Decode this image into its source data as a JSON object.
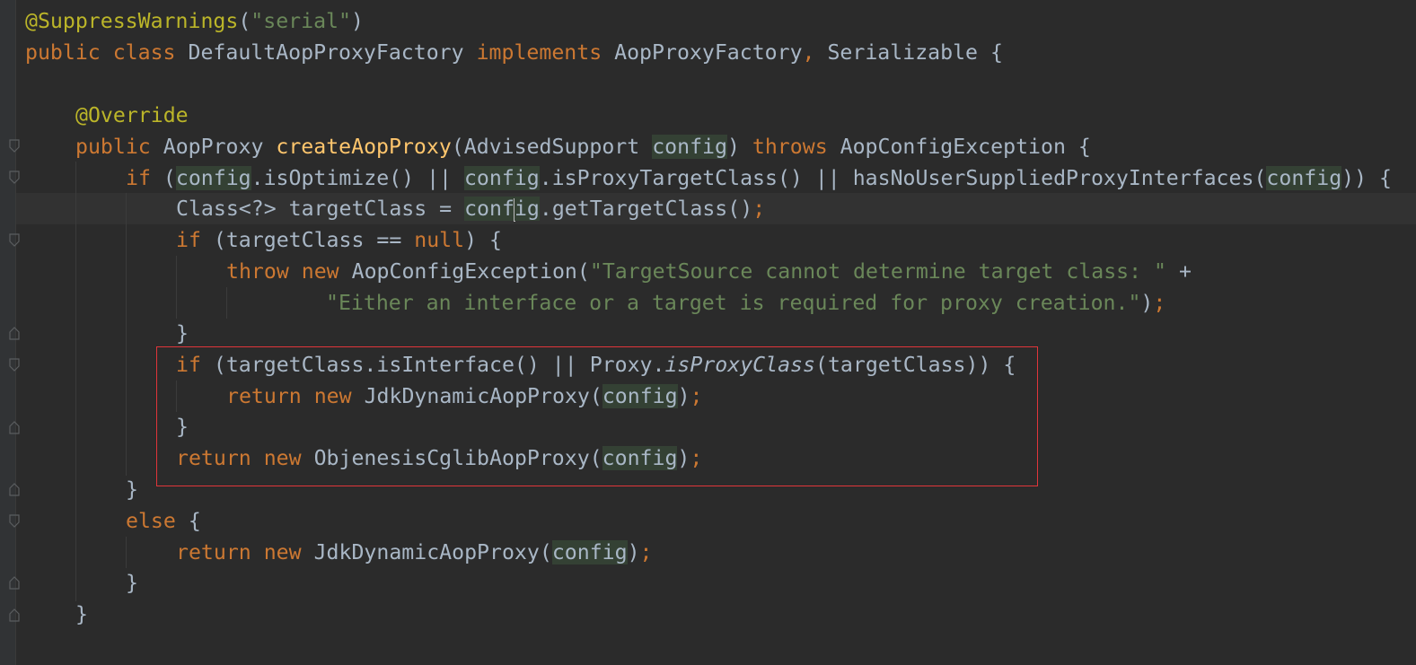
{
  "editor": {
    "language": "java",
    "theme_colors": {
      "background": "#2b2b2b",
      "keyword": "#cc7832",
      "annotation": "#bbb529",
      "string": "#6a8759",
      "method_declaration": "#ffc66d",
      "plain": "#a9b7c6",
      "usage_highlight": "#344134",
      "selection_box": "#e0353a"
    },
    "lines": [
      {
        "segments": [
          "@SuppressWarnings",
          "(",
          "\"serial\"",
          ")"
        ]
      },
      {
        "segments": [
          "public class ",
          "DefaultAopProxyFactory ",
          "implements ",
          "AopProxyFactory",
          ", ",
          "Serializable {"
        ]
      },
      {
        "segments": []
      },
      {
        "segments": [
          "@Override"
        ]
      },
      {
        "segments": [
          "public ",
          "AopProxy ",
          "createAopProxy",
          "(AdvisedSupport ",
          "config",
          ") ",
          "throws ",
          "AopConfigException {"
        ]
      },
      {
        "segments": [
          "if ",
          "(",
          "config",
          ".isOptimize() || ",
          "config",
          ".isProxyTargetClass() || hasNoUserSuppliedProxyInterfaces(",
          "config",
          ")) {"
        ]
      },
      {
        "segments": [
          "Class<?> targetClass = ",
          "conf",
          "ig",
          ".getTargetClass()",
          ";"
        ]
      },
      {
        "segments": [
          "if ",
          "(targetClass == ",
          "null",
          ") {"
        ]
      },
      {
        "segments": [
          "throw new ",
          "AopConfigException(",
          "\"TargetSource cannot determine target class: \" ",
          "+"
        ]
      },
      {
        "segments": [
          "\"Either an interface or a target is required for proxy creation.\"",
          ")",
          ";"
        ]
      },
      {
        "segments": [
          "}"
        ]
      },
      {
        "segments": [
          "if ",
          "(targetClass.isInterface() || Proxy.",
          "isProxyClass",
          "(targetClass)) {"
        ]
      },
      {
        "segments": [
          "return new ",
          "JdkDynamicAopProxy(",
          "config",
          ")",
          ";"
        ]
      },
      {
        "segments": [
          "}"
        ]
      },
      {
        "segments": [
          "return new ",
          "ObjenesisCglibAopProxy(",
          "config",
          ")",
          ";"
        ]
      },
      {
        "segments": [
          "}"
        ]
      },
      {
        "segments": [
          "else ",
          "{"
        ]
      },
      {
        "segments": [
          "return new ",
          "JdkDynamicAopProxy(",
          "config",
          ")",
          ";"
        ]
      },
      {
        "segments": [
          "}"
        ]
      },
      {
        "segments": [
          "}"
        ]
      }
    ]
  }
}
